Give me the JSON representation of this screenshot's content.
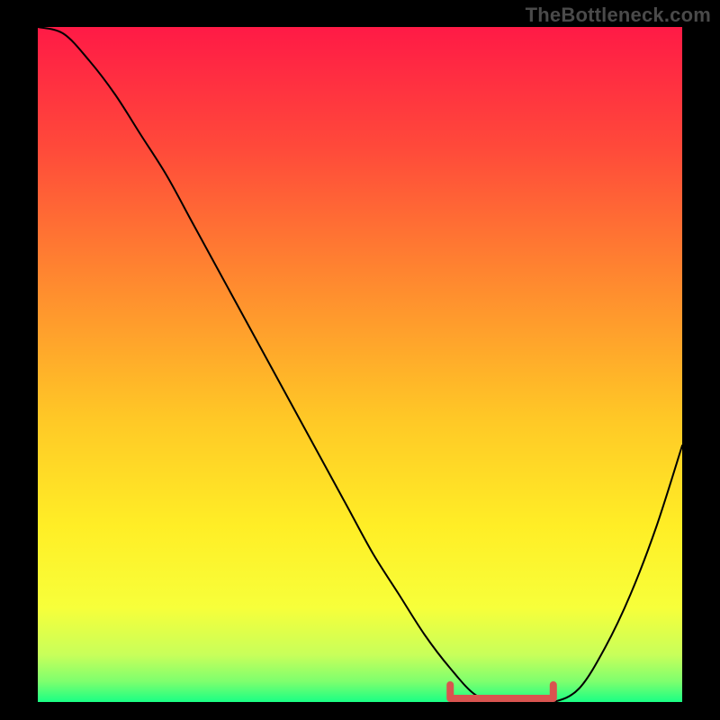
{
  "watermark": "TheBottleneck.com",
  "chart_data": {
    "type": "line",
    "title": "",
    "xlabel": "",
    "ylabel": "",
    "xlim": [
      0,
      100
    ],
    "ylim": [
      0,
      100
    ],
    "grid": false,
    "legend": false,
    "background_gradient": {
      "stops": [
        {
          "offset": 0.0,
          "color": "#ff1a46"
        },
        {
          "offset": 0.18,
          "color": "#ff4a3a"
        },
        {
          "offset": 0.38,
          "color": "#ff8a2f"
        },
        {
          "offset": 0.58,
          "color": "#ffc826"
        },
        {
          "offset": 0.74,
          "color": "#ffee26"
        },
        {
          "offset": 0.86,
          "color": "#f7ff3a"
        },
        {
          "offset": 0.93,
          "color": "#c8ff5a"
        },
        {
          "offset": 0.97,
          "color": "#7dff6e"
        },
        {
          "offset": 1.0,
          "color": "#1aff84"
        }
      ]
    },
    "series": [
      {
        "name": "bottleneck-curve",
        "color": "#000000",
        "stroke_width": 2,
        "x": [
          0,
          4,
          8,
          12,
          16,
          20,
          24,
          28,
          32,
          36,
          40,
          44,
          48,
          52,
          56,
          60,
          64,
          68,
          72,
          76,
          80,
          84,
          88,
          92,
          96,
          100
        ],
        "values": [
          100,
          99,
          95,
          90,
          84,
          78,
          71,
          64,
          57,
          50,
          43,
          36,
          29,
          22,
          16,
          10,
          5,
          1,
          0,
          0,
          0,
          2,
          8,
          16,
          26,
          38
        ]
      }
    ],
    "highlight": {
      "name": "optimal-range",
      "color": "#d9544f",
      "stroke_width": 8,
      "x_start": 64,
      "x_end": 80,
      "y": 0,
      "end_tick_height": 2.0
    }
  }
}
